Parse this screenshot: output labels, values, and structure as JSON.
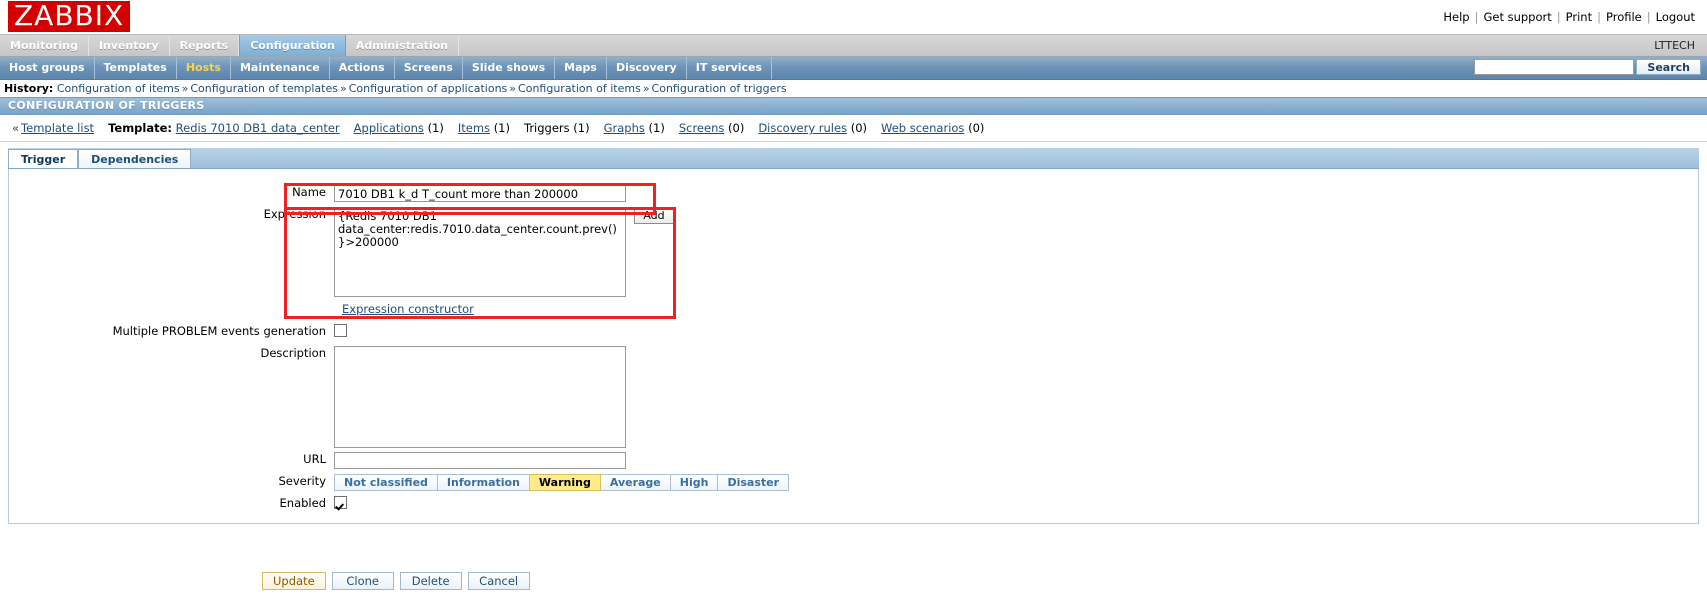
{
  "brand": {
    "logo_text": "ZABBIX"
  },
  "top_links": [
    {
      "label": "Help"
    },
    {
      "label": "Get support"
    },
    {
      "label": "Print"
    },
    {
      "label": "Profile"
    },
    {
      "label": "Logout"
    }
  ],
  "main_menu": {
    "items": [
      {
        "label": "Monitoring",
        "selected": false
      },
      {
        "label": "Inventory",
        "selected": false
      },
      {
        "label": "Reports",
        "selected": false
      },
      {
        "label": "Configuration",
        "selected": true
      },
      {
        "label": "Administration",
        "selected": false
      }
    ],
    "account": "LTTECH"
  },
  "sub_menu": {
    "items": [
      {
        "label": "Host groups",
        "selected": false
      },
      {
        "label": "Templates",
        "selected": false
      },
      {
        "label": "Hosts",
        "selected": true
      },
      {
        "label": "Maintenance",
        "selected": false
      },
      {
        "label": "Actions",
        "selected": false
      },
      {
        "label": "Screens",
        "selected": false
      },
      {
        "label": "Slide shows",
        "selected": false
      },
      {
        "label": "Maps",
        "selected": false
      },
      {
        "label": "Discovery",
        "selected": false
      },
      {
        "label": "IT services",
        "selected": false
      }
    ],
    "search": {
      "value": "",
      "placeholder": "",
      "button_label": "Search"
    }
  },
  "history": {
    "label": "History:",
    "items": [
      "Configuration of items",
      "Configuration of templates",
      "Configuration of applications",
      "Configuration of items",
      "Configuration of triggers"
    ],
    "separator": "»"
  },
  "page_title": "CONFIGURATION OF TRIGGERS",
  "template_nav": {
    "chevron": "«",
    "template_list_label": "Template list",
    "template_label": "Template:",
    "template_name": "Redis 7010 DB1 data_center",
    "links": [
      {
        "label": "Applications",
        "count": "(1)",
        "current": false
      },
      {
        "label": "Items",
        "count": "(1)",
        "current": false
      },
      {
        "label": "Triggers",
        "count": "(1)",
        "current": true
      },
      {
        "label": "Graphs",
        "count": "(1)",
        "current": false
      },
      {
        "label": "Screens",
        "count": "(0)",
        "current": false
      },
      {
        "label": "Discovery rules",
        "count": "(0)",
        "current": false
      },
      {
        "label": "Web scenarios",
        "count": "(0)",
        "current": false
      }
    ]
  },
  "tabs": [
    {
      "label": "Trigger",
      "active": true
    },
    {
      "label": "Dependencies",
      "active": false
    }
  ],
  "form": {
    "name": {
      "label": "Name",
      "value": "7010 DB1 k_d T_count more than 200000",
      "placeholder": ""
    },
    "expression": {
      "label": "Expression",
      "value": "{Redis 7010 DB1 data_center:redis.7010.data_center.count.prev()}>200000",
      "add_button_label": "Add",
      "constructor_link": "Expression constructor"
    },
    "multiple_events": {
      "label": "Multiple PROBLEM events generation",
      "checked": false
    },
    "description": {
      "label": "Description",
      "value": "",
      "placeholder": ""
    },
    "url": {
      "label": "URL",
      "value": "",
      "placeholder": ""
    },
    "severity": {
      "label": "Severity",
      "options": [
        {
          "label": "Not classified",
          "active": false
        },
        {
          "label": "Information",
          "active": false
        },
        {
          "label": "Warning",
          "active": true
        },
        {
          "label": "Average",
          "active": false
        },
        {
          "label": "High",
          "active": false
        },
        {
          "label": "Disaster",
          "active": false
        }
      ]
    },
    "enabled": {
      "label": "Enabled",
      "checked": true
    }
  },
  "footer_buttons": [
    {
      "label": "Update",
      "primary": true
    },
    {
      "label": "Clone",
      "primary": false
    },
    {
      "label": "Delete",
      "primary": false
    },
    {
      "label": "Cancel",
      "primary": false
    }
  ],
  "colors": {
    "brand_red": "#d40000",
    "annotation_red": "#ee2222",
    "selected_menu_blue": "#7cb0d8",
    "warning_yellow": "#ffeb8a",
    "link_blue": "#1f4e79"
  }
}
